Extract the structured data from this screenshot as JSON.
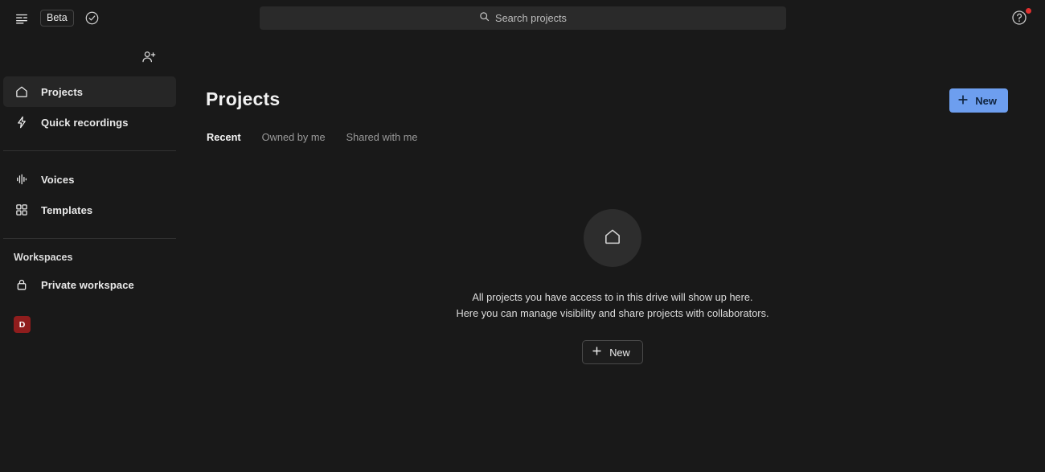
{
  "topbar": {
    "menu_icon": "panel-toggle-icon",
    "beta_label": "Beta",
    "status_icon": "check-circle-icon",
    "search": {
      "placeholder": "Search projects",
      "icon": "search-icon"
    },
    "help_icon": "help-circle-icon",
    "help_has_notification": true,
    "notification_color": "#e0302f"
  },
  "sidebar": {
    "add_user_icon": "add-user-icon",
    "items": [
      {
        "label": "Projects",
        "icon": "home-icon",
        "active": true
      },
      {
        "label": "Quick recordings",
        "icon": "lightning-bolt-icon",
        "active": false
      },
      {
        "label": "Voices",
        "icon": "waveform-icon",
        "active": false
      },
      {
        "label": "Templates",
        "icon": "grid-icon",
        "active": false
      }
    ],
    "section_title": "Workspaces",
    "workspace": {
      "label": "Private workspace",
      "icon": "lock-icon"
    },
    "avatar": {
      "initial": "D",
      "color": "#8f1d1d"
    }
  },
  "main": {
    "title": "Projects",
    "new_button_primary": {
      "label": "New",
      "icon": "plus-icon",
      "color": "#6d9eef"
    },
    "tabs": [
      {
        "label": "Recent",
        "active": true
      },
      {
        "label": "Owned by me",
        "active": false
      },
      {
        "label": "Shared with me",
        "active": false
      }
    ],
    "empty_state": {
      "icon": "home-icon",
      "line1": "All projects you have access to in this drive will show up here.",
      "line2": "Here you can manage visibility and share projects with collaborators.",
      "new_button": {
        "label": "New",
        "icon": "plus-icon"
      }
    }
  }
}
